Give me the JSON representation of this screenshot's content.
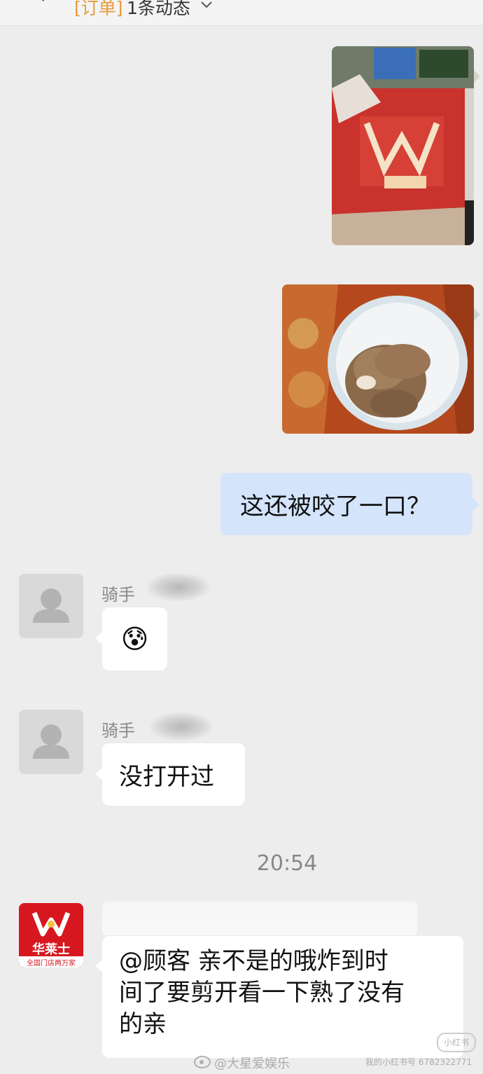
{
  "header": {
    "order_tag": "[订单]",
    "order_status": "1条动态"
  },
  "messages": [
    {
      "kind": "image-out",
      "subject": "华莱士 paper delivery bag on counter"
    },
    {
      "kind": "image-out",
      "subject": "fried chicken pieces in white bowl"
    },
    {
      "kind": "text-out",
      "text": "这还被咬了一口？"
    },
    {
      "kind": "emoji-in",
      "sender": "骑手",
      "emoji": "😰"
    },
    {
      "kind": "text-in",
      "sender": "骑手",
      "text": "没打开过"
    }
  ],
  "timestamp": "20:54",
  "merchant": {
    "logo_brand": "华莱士",
    "logo_slogan": "全国门店两万家",
    "line1": "@顾客 亲不是的哦炸到时",
    "line2": "间了要剪开看一下熟了没有",
    "line3": "的亲"
  },
  "watermarks": {
    "weibo": "@大星爱娱乐",
    "xhs_logo": "小红书",
    "xhs_id": "我的小红书号 6782322771"
  },
  "colors": {
    "outgoing_bubble": "#d3e4fb",
    "incoming_bubble": "#ffffff",
    "background": "#ededed",
    "order_accent": "#e89a3c",
    "brand_red": "#d7171f"
  }
}
